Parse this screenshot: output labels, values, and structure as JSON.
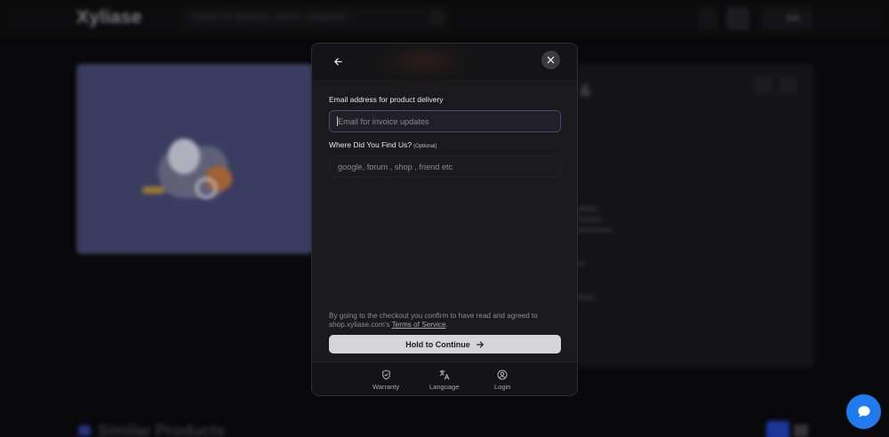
{
  "header": {
    "logo": "Xyliase",
    "search_placeholder": "Search for products, sellers, categories",
    "sell_label": "Sell"
  },
  "product": {
    "title_fragment": "&",
    "section_title": "Similar Products"
  },
  "modal": {
    "email_label": "Email address for product delivery",
    "email_placeholder": "Email for invoice updates",
    "source_label": "Where Did You Find Us?",
    "source_optional": "(Optional)",
    "source_placeholder": "google, forum , shop , friend etc",
    "terms_prefix": "By going to the checkout you confirm to have read and agreed to shop.xyliase.com's ",
    "terms_link": "Terms of Service",
    "terms_suffix": ".",
    "continue_label": "Hold to Continue",
    "footer": {
      "warranty": "Warranty",
      "language": "Language",
      "login": "Login"
    }
  },
  "colors": {
    "modal_bg": "#1a1a1d",
    "input_focus_border": "#46467a",
    "continue_bg": "#d6d6d9",
    "chat_accent": "#1f7cf0",
    "hero_bg": "#42456e"
  },
  "icons": {
    "back": "arrow-left-icon",
    "close": "close-icon",
    "continue": "arrow-right-icon",
    "warranty": "shield-check-icon",
    "language": "translate-icon",
    "login": "user-circle-icon",
    "chat": "chat-bubble-icon"
  }
}
